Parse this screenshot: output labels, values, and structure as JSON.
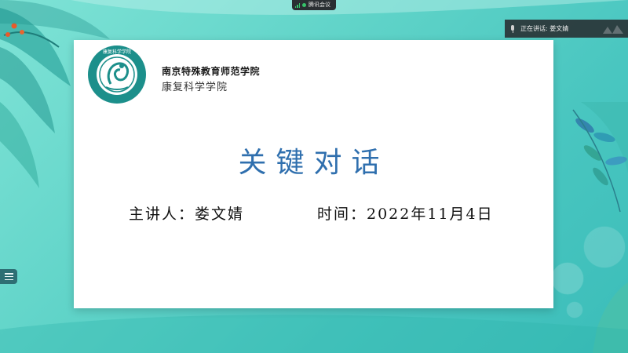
{
  "meeting": {
    "app_title": "腾讯会议",
    "speaker_banner": "正在讲话: 娄文婧"
  },
  "slide": {
    "school_name": "南京特殊教育师范学院",
    "college_name": "康复科学学院",
    "logo_ring_text": "康复科学学院",
    "title": "关键对话",
    "presenter_label": "主讲人：娄文婧",
    "time_label": "时间：2022年11月4日"
  },
  "colors": {
    "background": "#5fd3c8",
    "title": "#2f6fae",
    "logo_teal": "#1c8f8b"
  },
  "icons": {
    "signal": "signal-icon",
    "status": "dot-icon",
    "mic": "mic-icon",
    "list": "list-icon"
  }
}
